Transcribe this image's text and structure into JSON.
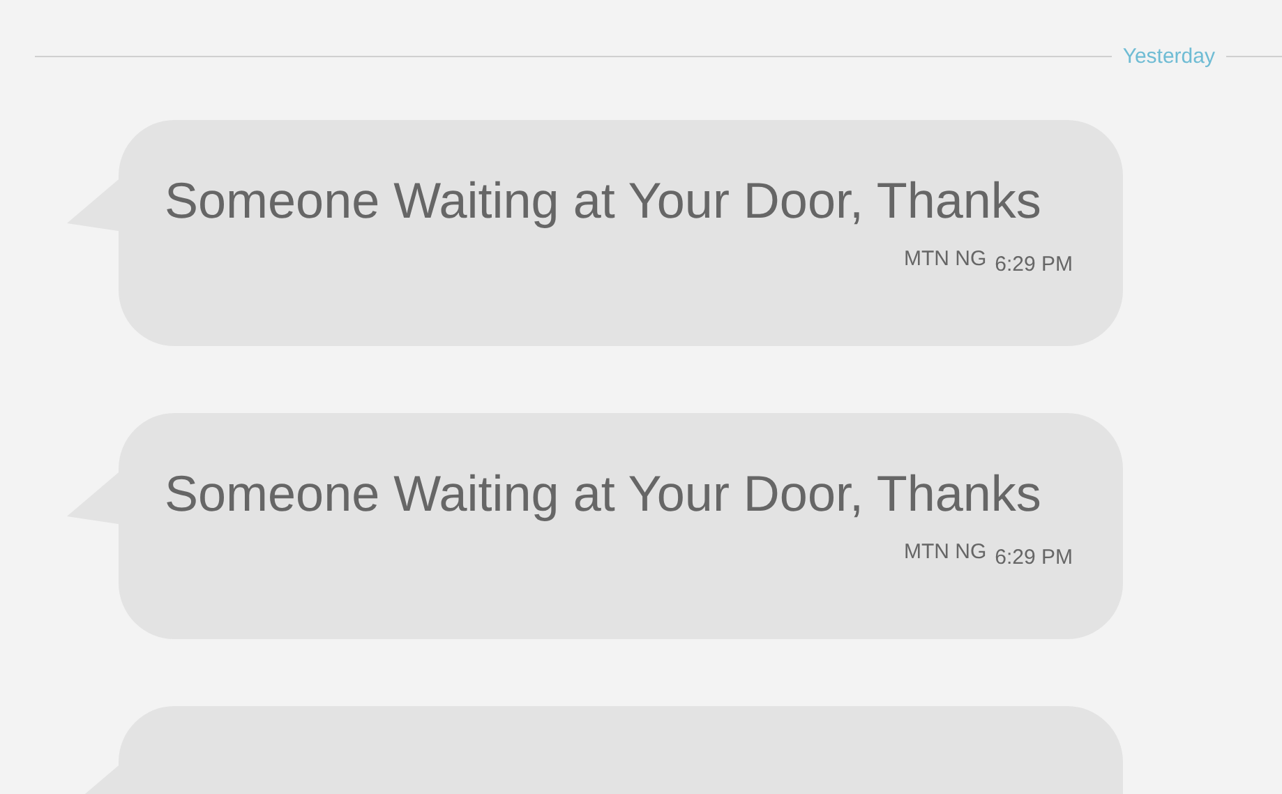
{
  "date_divider": {
    "label": "Yesterday"
  },
  "messages": [
    {
      "kind": "full",
      "text": "Someone Waiting at Your Door, Thanks",
      "sender": "MTN NG",
      "time": "6:29 PM"
    },
    {
      "kind": "full",
      "text": "Someone Waiting at Your Door, Thanks",
      "sender": "MTN NG",
      "time": "6:29 PM"
    },
    {
      "kind": "clipped"
    }
  ]
}
